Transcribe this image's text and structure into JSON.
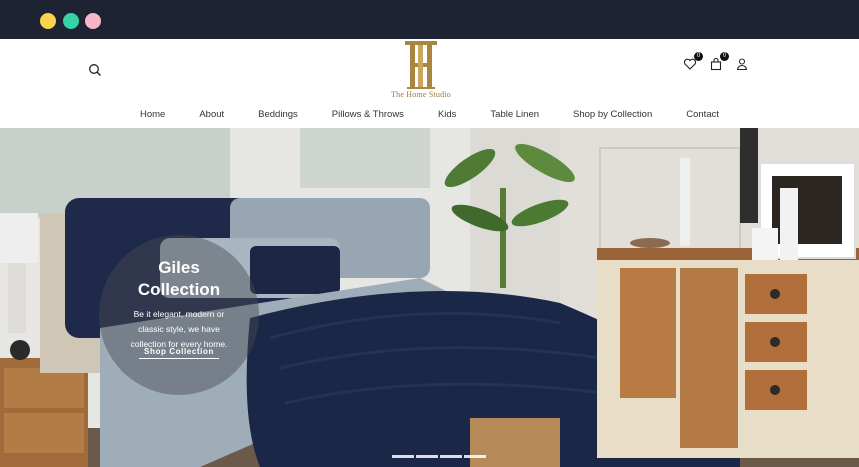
{
  "window": {
    "dots": [
      "#fcd34d",
      "#34d3a8",
      "#f6b7c6"
    ]
  },
  "header": {
    "logo_text": "The Home Studio",
    "wishlist_count": "0",
    "cart_count": "0"
  },
  "nav": [
    "Home",
    "About",
    "Beddings",
    "Pillows & Throws",
    "Kids",
    "Table Linen",
    "Shop by Collection",
    "Contact"
  ],
  "hero": {
    "title_line1": "Giles",
    "title_line2": "Collection",
    "text": "Be it elegant, modern or classic style, we have collection for every home.",
    "cta": "Shop Collection",
    "slides": 4
  },
  "icons": [
    "search-icon",
    "heart-icon",
    "bag-icon",
    "user-icon"
  ]
}
